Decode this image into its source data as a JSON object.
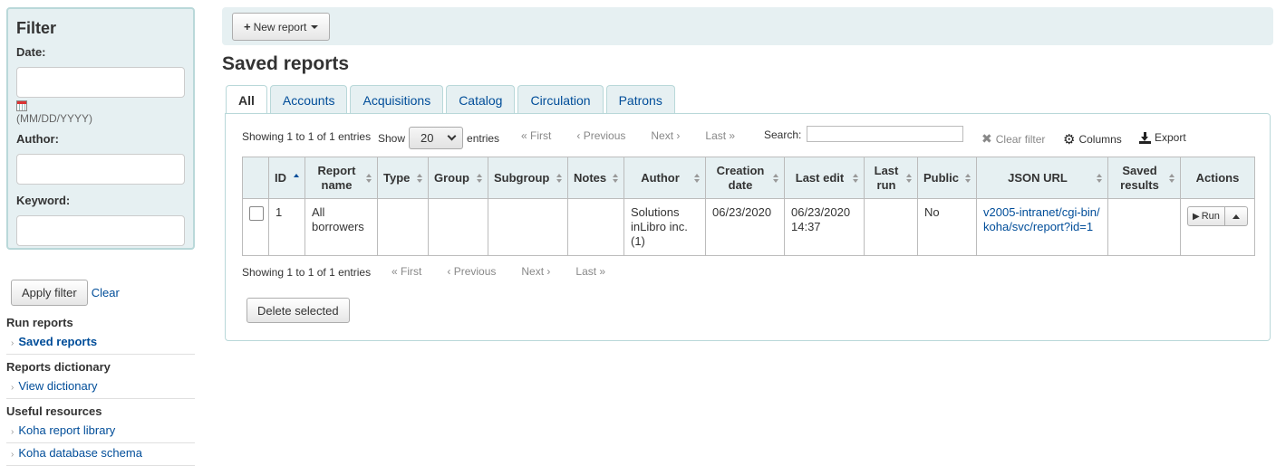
{
  "filter": {
    "title": "Filter",
    "date_label": "Date:",
    "date_hint": "(MM/DD/YYYY)",
    "author_label": "Author:",
    "keyword_label": "Keyword:",
    "apply_label": "Apply filter",
    "clear_label": "Clear"
  },
  "sidebar": {
    "sections": [
      {
        "heading": "Run reports",
        "items": [
          "Saved reports"
        ]
      },
      {
        "heading": "Reports dictionary",
        "items": [
          "View dictionary"
        ]
      },
      {
        "heading": "Useful resources",
        "items": [
          "Koha report library",
          "Koha database schema"
        ]
      }
    ]
  },
  "toolbar": {
    "new_report_label": "New report"
  },
  "page_title": "Saved reports",
  "tabs": [
    "All",
    "Accounts",
    "Acquisitions",
    "Catalog",
    "Circulation",
    "Patrons"
  ],
  "active_tab": "All",
  "table_controls": {
    "info_top": "Showing 1 to 1 of 1 entries",
    "info_bottom": "Showing 1 to 1 of 1 entries",
    "show_label": "Show",
    "entries_label": "entries",
    "page_size": "20",
    "pager": {
      "first": "First",
      "previous": "Previous",
      "next": "Next",
      "last": "Last"
    },
    "search_label": "Search:",
    "search_value": "",
    "clear_filter_label": "Clear filter",
    "columns_label": "Columns",
    "export_label": "Export"
  },
  "table": {
    "columns": [
      "",
      "ID",
      "Report name",
      "Type",
      "Group",
      "Subgroup",
      "Notes",
      "Author",
      "Creation date",
      "Last edit",
      "Last run",
      "Public",
      "JSON URL",
      "Saved results",
      "Actions"
    ],
    "rows": [
      {
        "id": "1",
        "name": "All borrowers",
        "type": "",
        "group": "",
        "subgroup": "",
        "notes": "",
        "author": "Solutions inLibro inc. (1)",
        "creation_date": "06/23/2020",
        "last_edit": "06/23/2020 14:37",
        "last_run": "",
        "public": "No",
        "json_url": "v2005-intranet/cgi-bin/koha/svc/report?id=1",
        "saved_results": "",
        "run_label": "Run"
      }
    ]
  },
  "delete_label": "Delete selected",
  "colors": {
    "link": "#004d99",
    "panel_bg": "#e6f0f2",
    "panel_border": "#b9d8d9"
  }
}
